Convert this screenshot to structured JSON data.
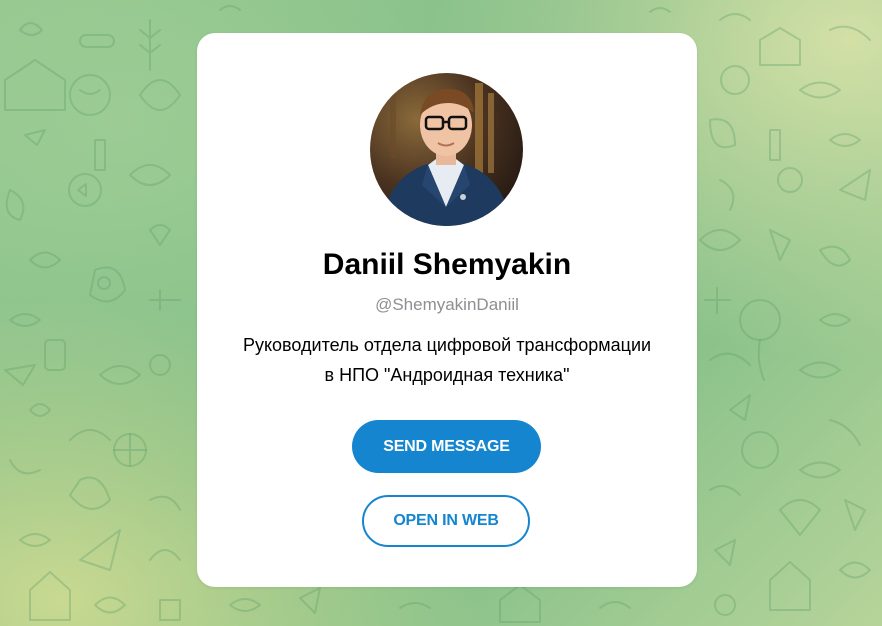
{
  "profile": {
    "name": "Daniil Shemyakin",
    "username": "@ShemyakinDaniil",
    "bio_line1": "Руководитель отдела цифровой трансформации",
    "bio_line2": "в НПО \"Андроидная техника\""
  },
  "actions": {
    "send_message_label": "SEND MESSAGE",
    "open_in_web_label": "OPEN IN WEB"
  },
  "colors": {
    "accent": "#1585cf",
    "background_green": "#7cba86",
    "card": "#ffffff",
    "username_gray": "#8e8e93"
  },
  "icons": [
    "avatar-photo",
    "doodle-pattern-background"
  ]
}
